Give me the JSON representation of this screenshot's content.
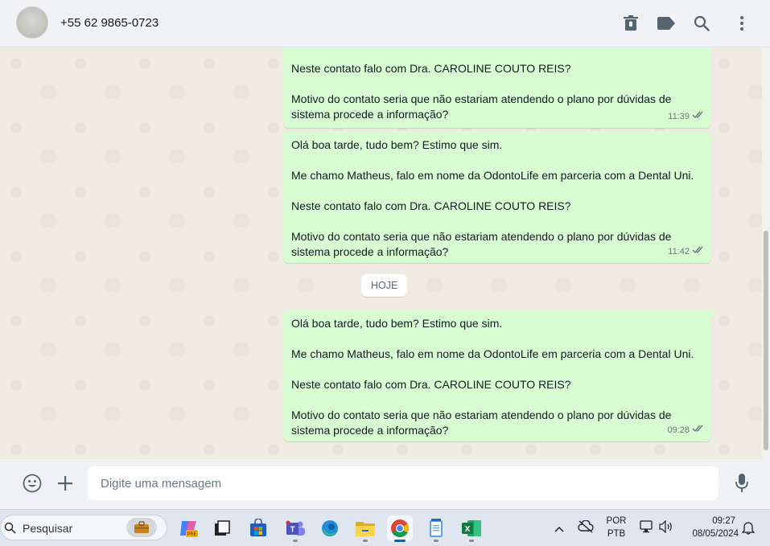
{
  "header": {
    "contact_name": "+55 62 9865-0723",
    "icons": [
      "delete-icon",
      "label-icon",
      "search-icon",
      "menu-icon"
    ]
  },
  "chat": {
    "date_divider": "HOJE",
    "messages": [
      {
        "paragraphs": [
          "Neste contato falo com Dra. CAROLINE COUTO REIS?",
          "Motivo do contato seria que não estariam atendendo o plano por dúvidas de sistema procede a informação?"
        ],
        "time": "11:39",
        "status": "read-ticks"
      },
      {
        "paragraphs": [
          "Olá boa tarde, tudo bem? Estimo que sim.",
          "Me chamo Matheus, falo em nome da OdontoLife em parceria com a Dental Uni.",
          "Neste contato falo com Dra. CAROLINE COUTO REIS?",
          "Motivo do contato seria que não estariam atendendo o plano por dúvidas de sistema procede a informação?"
        ],
        "time": "11:42",
        "status": "read-ticks"
      },
      {
        "paragraphs": [
          "Olá boa tarde, tudo bem? Estimo que sim.",
          "Me chamo Matheus, falo em nome da OdontoLife em parceria com a Dental Uni.",
          "Neste contato falo com Dra. CAROLINE COUTO REIS?",
          "Motivo do contato seria que não estariam atendendo o plano por dúvidas de sistema procede a informação?"
        ],
        "time": "09:28",
        "status": "read-ticks"
      }
    ]
  },
  "composer": {
    "placeholder": "Digite uma mensagem",
    "value": ""
  },
  "taskbar": {
    "search_label": "Pesquisar",
    "apps": [
      "copilot-pre",
      "task-view",
      "microsoft-store",
      "teams",
      "edge",
      "file-explorer",
      "chrome",
      "notepad",
      "excel"
    ],
    "lang_line1": "POR",
    "lang_line2": "PTB",
    "time": "09:27",
    "date": "08/05/2024"
  },
  "colors": {
    "outgoing_bubble": "#d9fdd3",
    "chat_background": "#efeae2",
    "header_background": "#f0f2f5",
    "read_ticks": "#667781"
  }
}
